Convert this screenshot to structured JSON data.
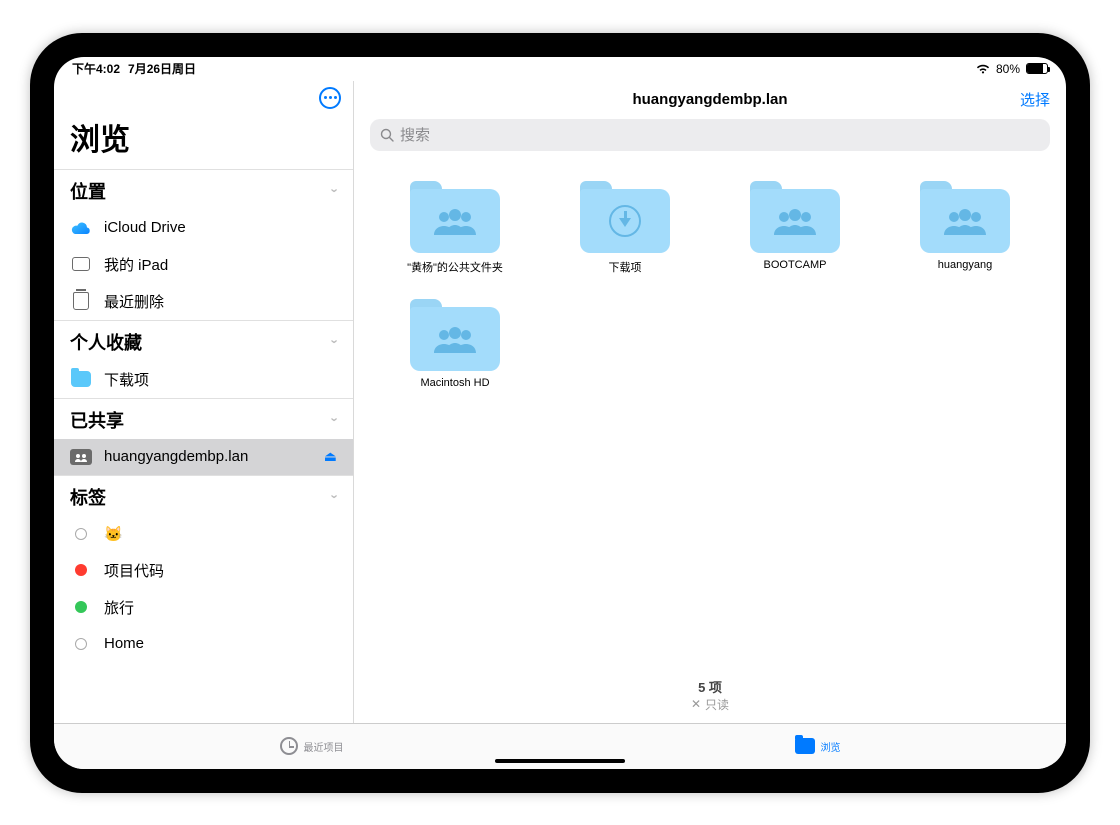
{
  "status": {
    "time": "下午4:02",
    "date": "7月26日周日",
    "battery": "80%"
  },
  "sidebar": {
    "browse_title": "浏览",
    "sections": {
      "locations": {
        "header": "位置",
        "items": [
          "iCloud Drive",
          "我的 iPad",
          "最近删除"
        ]
      },
      "favorites": {
        "header": "个人收藏",
        "items": [
          "下载项"
        ]
      },
      "shared": {
        "header": "已共享",
        "items": [
          "huangyangdembp.lan"
        ]
      },
      "tags": {
        "header": "标签",
        "items": [
          {
            "label": "🐱",
            "color": ""
          },
          {
            "label": "项目代码",
            "color": "#ff3b30"
          },
          {
            "label": "旅行",
            "color": "#34c759"
          },
          {
            "label": "Home",
            "color": ""
          }
        ]
      }
    }
  },
  "main": {
    "title": "huangyangdembp.lan",
    "select": "选择",
    "search_placeholder": "搜索",
    "items": [
      "\"黄杨\"的公共文件夹",
      "下载项",
      "BOOTCAMP",
      "huangyang",
      "Macintosh HD"
    ],
    "count": "5 项",
    "readonly": "只读"
  },
  "tabs": {
    "recent": "最近项目",
    "browse": "浏览"
  }
}
